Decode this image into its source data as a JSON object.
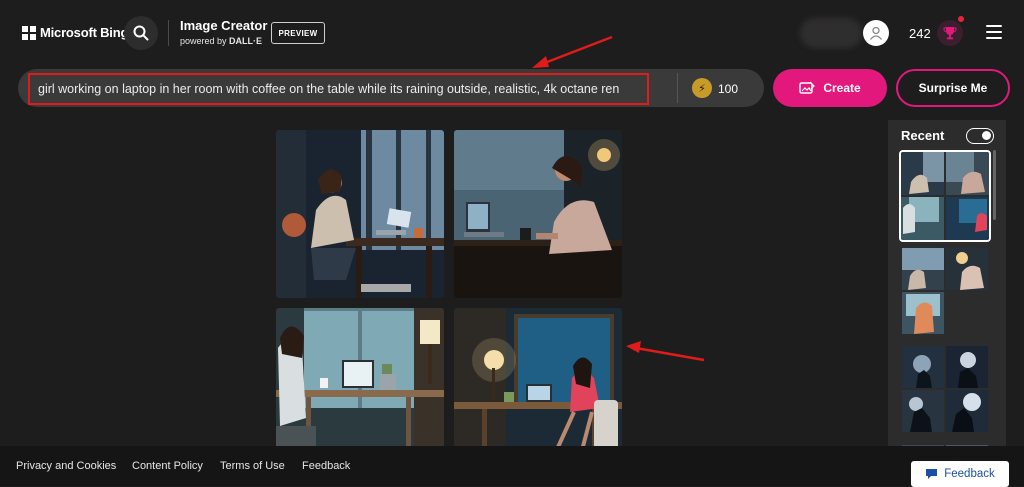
{
  "header": {
    "brand": "Microsoft Bing",
    "product_title": "Image Creator",
    "powered_by": "powered by",
    "powered_by_brand": "DALL·E",
    "preview_badge": "PREVIEW",
    "rewards_count": "242"
  },
  "prompt": {
    "text": "girl working on laptop in her room with coffee on the table while its raining outside, realistic, 4k octane ren",
    "boost_count": "100",
    "create_label": "Create",
    "surprise_label": "Surprise Me"
  },
  "recent": {
    "title": "Recent"
  },
  "footer": {
    "links": [
      "Privacy and Cookies",
      "Content Policy",
      "Terms of Use",
      "Feedback"
    ],
    "feedback_button": "Feedback"
  },
  "colors": {
    "accent": "#e3187d",
    "background": "#1e1d1d",
    "annotation": "#e01b1b"
  }
}
